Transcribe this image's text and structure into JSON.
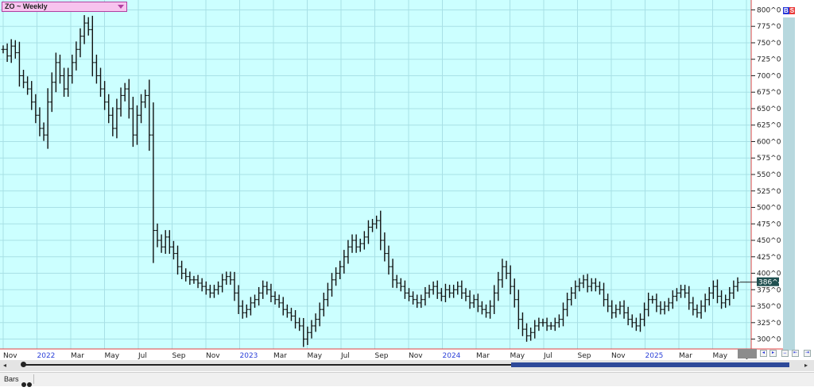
{
  "symbol_box": {
    "label": "ZO ~ Weekly"
  },
  "badge": {
    "b": "B",
    "s": "S"
  },
  "status": {
    "mode": "Bars"
  },
  "price_tag": "386^4",
  "colors": {
    "background": "#ccffff",
    "grid": "#a8e0e6",
    "bars": "#111111",
    "axis": "#e04040",
    "year_label": "#2a3fd8"
  },
  "icons": {
    "scroll_left": "left-arrow-icon",
    "scroll_right": "right-arrow-icon",
    "toggle": "bars-toggle-icon"
  },
  "chart_data": {
    "type": "ohlc-bar",
    "title": "ZO ~ Weekly",
    "y_ticks": [
      {
        "value": 300,
        "label": "300^0"
      },
      {
        "value": 325,
        "label": "325^0"
      },
      {
        "value": 350,
        "label": "350^0"
      },
      {
        "value": 375,
        "label": "375^0"
      },
      {
        "value": 400,
        "label": "400^0"
      },
      {
        "value": 425,
        "label": "425^0"
      },
      {
        "value": 450,
        "label": "450^0"
      },
      {
        "value": 475,
        "label": "475^0"
      },
      {
        "value": 500,
        "label": "500^0"
      },
      {
        "value": 525,
        "label": "525^0"
      },
      {
        "value": 550,
        "label": "550^0"
      },
      {
        "value": 575,
        "label": "575^0"
      },
      {
        "value": 600,
        "label": "600^0"
      },
      {
        "value": 625,
        "label": "625^0"
      },
      {
        "value": 650,
        "label": "650^0"
      },
      {
        "value": 675,
        "label": "675^0"
      },
      {
        "value": 700,
        "label": "700^0"
      },
      {
        "value": 725,
        "label": "725^0"
      },
      {
        "value": 750,
        "label": "750^0"
      },
      {
        "value": 775,
        "label": "775^0"
      },
      {
        "value": 800,
        "label": "800^0"
      }
    ],
    "x_ticks": [
      {
        "label": "Nov",
        "year": false
      },
      {
        "label": "2022",
        "year": true
      },
      {
        "label": "Mar",
        "year": false
      },
      {
        "label": "May",
        "year": false
      },
      {
        "label": "Jul",
        "year": false
      },
      {
        "label": "Sep",
        "year": false
      },
      {
        "label": "Nov",
        "year": false
      },
      {
        "label": "2023",
        "year": true
      },
      {
        "label": "Mar",
        "year": false
      },
      {
        "label": "May",
        "year": false
      },
      {
        "label": "Jul",
        "year": false
      },
      {
        "label": "Sep",
        "year": false
      },
      {
        "label": "Nov",
        "year": false
      },
      {
        "label": "2024",
        "year": true
      },
      {
        "label": "Mar",
        "year": false
      },
      {
        "label": "May",
        "year": false
      },
      {
        "label": "Jul",
        "year": false
      },
      {
        "label": "Sep",
        "year": false
      },
      {
        "label": "Nov",
        "year": false
      },
      {
        "label": "2025",
        "year": true
      },
      {
        "label": "Mar",
        "year": false
      },
      {
        "label": "May",
        "year": false
      },
      {
        "label": "Jul",
        "year": false
      }
    ],
    "ylim": [
      285,
      815
    ],
    "last_price": 386.5,
    "close": [
      740,
      730,
      745,
      735,
      700,
      690,
      680,
      660,
      640,
      620,
      610,
      660,
      690,
      720,
      700,
      680,
      700,
      720,
      740,
      760,
      780,
      770,
      720,
      700,
      680,
      660,
      640,
      620,
      650,
      670,
      680,
      650,
      610,
      640,
      660,
      670,
      610,
      465,
      450,
      440,
      455,
      440,
      430,
      410,
      400,
      395,
      390,
      390,
      385,
      380,
      375,
      370,
      375,
      380,
      390,
      395,
      390,
      370,
      350,
      340,
      345,
      355,
      360,
      370,
      380,
      375,
      365,
      360,
      355,
      345,
      340,
      335,
      325,
      320,
      300,
      310,
      320,
      330,
      345,
      360,
      375,
      390,
      400,
      410,
      425,
      440,
      450,
      440,
      445,
      455,
      470,
      475,
      480,
      450,
      430,
      410,
      390,
      385,
      380,
      370,
      365,
      360,
      355,
      360,
      370,
      375,
      380,
      370,
      365,
      375,
      370,
      375,
      380,
      370,
      365,
      355,
      360,
      350,
      345,
      340,
      350,
      370,
      390,
      410,
      400,
      380,
      360,
      330,
      315,
      305,
      310,
      320,
      325,
      325,
      320,
      320,
      325,
      330,
      345,
      360,
      370,
      380,
      385,
      390,
      380,
      385,
      380,
      375,
      360,
      350,
      340,
      345,
      350,
      340,
      330,
      325,
      320,
      330,
      345,
      360,
      360,
      350,
      345,
      350,
      355,
      365,
      370,
      375,
      370,
      355,
      345,
      340,
      350,
      360,
      370,
      380,
      365,
      355,
      360,
      370,
      380,
      386
    ]
  }
}
